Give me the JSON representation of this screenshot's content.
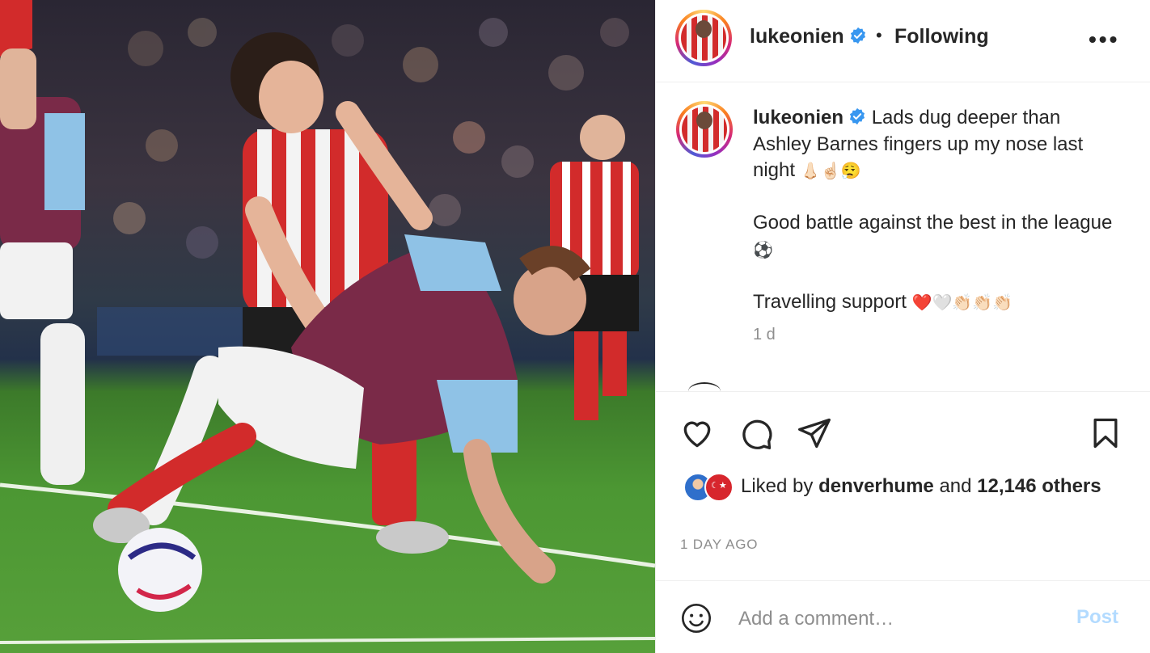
{
  "post": {
    "image_alt": "Football match photo",
    "header": {
      "username": "lukeonien",
      "separator": "•",
      "follow_status": "Following",
      "more_icon": "more-horizontal-icon",
      "more_label": "•••"
    },
    "caption": {
      "username": "lukeonien",
      "line1": "Lads dug deeper than Ashley Barnes fingers up my nose last night",
      "line1_emojis": "👃🏻☝🏻😮‍💨",
      "line2": "Good battle against the best in the league",
      "line2_emoji": "⚽",
      "line3": "Travelling support",
      "line3_emojis": "❤️🤍👏🏻👏🏻👏🏻",
      "time": "1 d"
    },
    "actions": {
      "like_icon": "heart-icon",
      "comment_icon": "comment-icon",
      "share_icon": "send-icon",
      "save_icon": "bookmark-icon"
    },
    "likes": {
      "prefix": "Liked by",
      "user": "denverhume",
      "and": "and",
      "count": "12,146",
      "suffix": "others"
    },
    "date": "1 DAY AGO",
    "comment": {
      "placeholder": "Add a comment…",
      "post_label": "Post",
      "post_color": "#b3dbff"
    }
  },
  "colors": {
    "verified_blue": "#3897f0",
    "text_primary": "#262626",
    "text_secondary": "#8e8e8e"
  }
}
